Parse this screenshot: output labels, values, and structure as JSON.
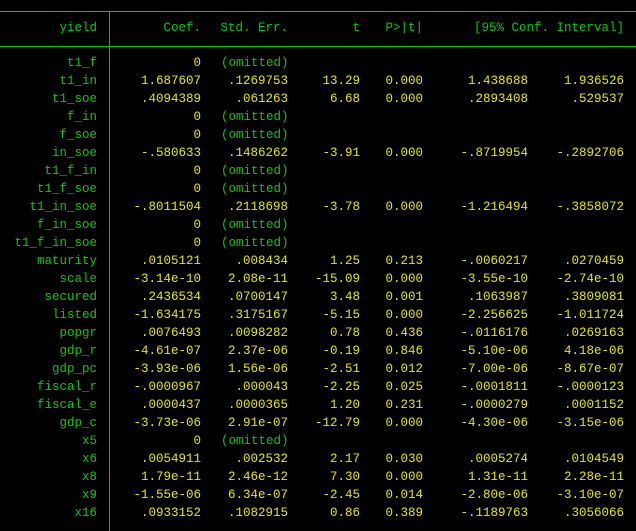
{
  "header": {
    "depvar": "yield",
    "coef": "Coef.",
    "se": "Std. Err.",
    "t": "t",
    "p": "P>|t|",
    "ci": "[95% Conf. Interval]"
  },
  "colors": {
    "green": "#00d000",
    "yellow": "#e8e800"
  },
  "rows": [
    {
      "name": "t1_f",
      "coef": "0",
      "omitted": "(omitted)"
    },
    {
      "name": "t1_in",
      "coef": "1.687607",
      "se": ".1269753",
      "t": "13.29",
      "p": "0.000",
      "lo": "1.438688",
      "hi": "1.936526"
    },
    {
      "name": "t1_soe",
      "coef": ".4094389",
      "se": ".061263",
      "t": "6.68",
      "p": "0.000",
      "lo": ".2893408",
      "hi": ".529537"
    },
    {
      "name": "f_in",
      "coef": "0",
      "omitted": "(omitted)"
    },
    {
      "name": "f_soe",
      "coef": "0",
      "omitted": "(omitted)"
    },
    {
      "name": "in_soe",
      "coef": "-.580633",
      "se": ".1486262",
      "t": "-3.91",
      "p": "0.000",
      "lo": "-.8719954",
      "hi": "-.2892706"
    },
    {
      "name": "t1_f_in",
      "coef": "0",
      "omitted": "(omitted)"
    },
    {
      "name": "t1_f_soe",
      "coef": "0",
      "omitted": "(omitted)"
    },
    {
      "name": "t1_in_soe",
      "coef": "-.8011504",
      "se": ".2118698",
      "t": "-3.78",
      "p": "0.000",
      "lo": "-1.216494",
      "hi": "-.3858072"
    },
    {
      "name": "f_in_soe",
      "coef": "0",
      "omitted": "(omitted)"
    },
    {
      "name": "t1_f_in_soe",
      "coef": "0",
      "omitted": "(omitted)"
    },
    {
      "name": "maturity",
      "coef": ".0105121",
      "se": ".008434",
      "t": "1.25",
      "p": "0.213",
      "lo": "-.0060217",
      "hi": ".0270459"
    },
    {
      "name": "scale",
      "coef": "-3.14e-10",
      "se": "2.08e-11",
      "t": "-15.09",
      "p": "0.000",
      "lo": "-3.55e-10",
      "hi": "-2.74e-10"
    },
    {
      "name": "secured",
      "coef": ".2436534",
      "se": ".0700147",
      "t": "3.48",
      "p": "0.001",
      "lo": ".1063987",
      "hi": ".3809081"
    },
    {
      "name": "listed",
      "coef": "-1.634175",
      "se": ".3175167",
      "t": "-5.15",
      "p": "0.000",
      "lo": "-2.256625",
      "hi": "-1.011724"
    },
    {
      "name": "popgr",
      "coef": ".0076493",
      "se": ".0098282",
      "t": "0.78",
      "p": "0.436",
      "lo": "-.0116176",
      "hi": ".0269163"
    },
    {
      "name": "gdp_r",
      "coef": "-4.61e-07",
      "se": "2.37e-06",
      "t": "-0.19",
      "p": "0.846",
      "lo": "-5.10e-06",
      "hi": "4.18e-06"
    },
    {
      "name": "gdp_pc",
      "coef": "-3.93e-06",
      "se": "1.56e-06",
      "t": "-2.51",
      "p": "0.012",
      "lo": "-7.00e-06",
      "hi": "-8.67e-07"
    },
    {
      "name": "fiscal_r",
      "coef": "-.0000967",
      "se": ".000043",
      "t": "-2.25",
      "p": "0.025",
      "lo": "-.0001811",
      "hi": "-.0000123"
    },
    {
      "name": "fiscal_e",
      "coef": ".0000437",
      "se": ".0000365",
      "t": "1.20",
      "p": "0.231",
      "lo": "-.0000279",
      "hi": ".0001152"
    },
    {
      "name": "gdp_c",
      "coef": "-3.73e-06",
      "se": "2.91e-07",
      "t": "-12.79",
      "p": "0.000",
      "lo": "-4.30e-06",
      "hi": "-3.15e-06"
    },
    {
      "name": "x5",
      "coef": "0",
      "omitted": "(omitted)"
    },
    {
      "name": "x6",
      "coef": ".0054911",
      "se": ".002532",
      "t": "2.17",
      "p": "0.030",
      "lo": ".0005274",
      "hi": ".0104549"
    },
    {
      "name": "x8",
      "coef": "1.79e-11",
      "se": "2.46e-12",
      "t": "7.30",
      "p": "0.000",
      "lo": "1.31e-11",
      "hi": "2.28e-11"
    },
    {
      "name": "x9",
      "coef": "-1.55e-06",
      "se": "6.34e-07",
      "t": "-2.45",
      "p": "0.014",
      "lo": "-2.80e-06",
      "hi": "-3.10e-07"
    },
    {
      "name": "x16",
      "coef": ".0933152",
      "se": ".1082915",
      "t": "0.86",
      "p": "0.389",
      "lo": "-.1189763",
      "hi": ".3056066"
    }
  ]
}
